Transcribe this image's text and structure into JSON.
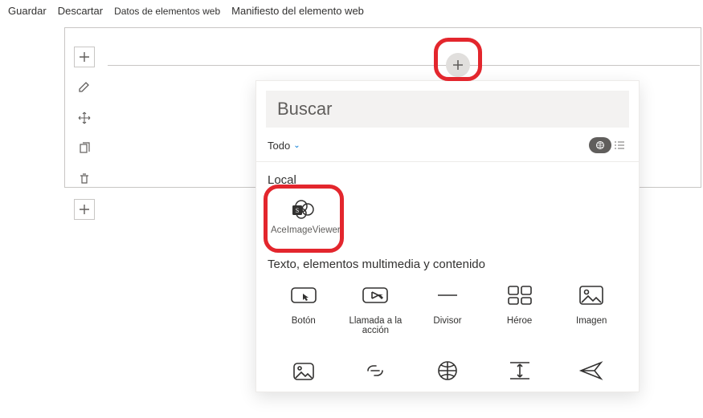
{
  "topbar": {
    "save": "Guardar",
    "discard": "Descartar",
    "webpart_data": "Datos de elementos web",
    "webpart_manifest": "Manifiesto del elemento web"
  },
  "toolbox": {
    "search_placeholder": "Buscar",
    "filter_all": "Todo",
    "section_local": "Local",
    "local_items": [
      {
        "label": "AceImageViewer"
      }
    ],
    "section_content": "Texto, elementos multimedia y contenido",
    "content_row1": [
      {
        "label": "Botón"
      },
      {
        "label": "Llamada a la acción"
      },
      {
        "label": "Divisor"
      },
      {
        "label": "Héroe"
      },
      {
        "label": "Imagen"
      }
    ]
  }
}
